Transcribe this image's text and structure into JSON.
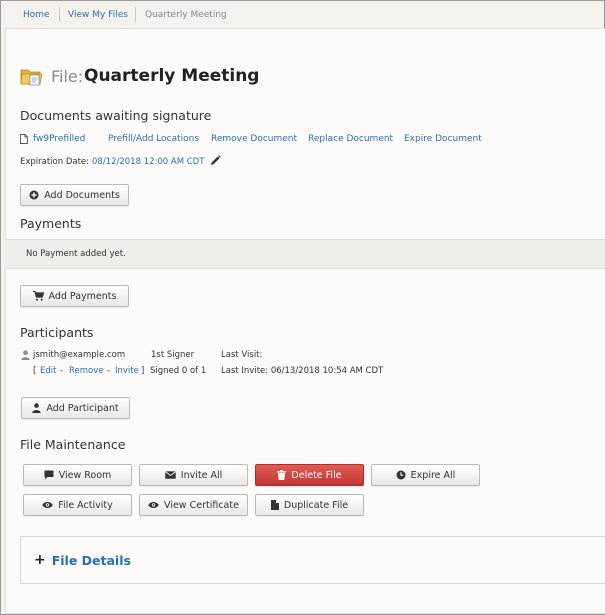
{
  "breadcrumb": {
    "home": "Home",
    "view_my_files": "View My Files",
    "current": "Quarterly Meeting"
  },
  "file": {
    "prefix": "File:",
    "name": "Quarterly Meeting"
  },
  "documents": {
    "heading": "Documents awaiting signature",
    "document_name": "fw9Prefilled",
    "actions": {
      "prefill": "Prefill/Add Locations",
      "remove": "Remove Document",
      "replace": "Replace Document",
      "expire": "Expire Document"
    },
    "expiration_label": "Expiration Date:",
    "expiration_value": "08/12/2018 12:00 AM CDT",
    "add_button": "Add Documents"
  },
  "payments": {
    "heading": "Payments",
    "empty_message": "No Payment added yet.",
    "add_button": "Add Payments"
  },
  "participants": {
    "heading": "Participants",
    "items": [
      {
        "email": "jsmith@example.com",
        "role": "1st Signer",
        "last_visit_label": "Last Visit:",
        "last_visit_value": "",
        "bracket_open": "[",
        "edit": "Edit",
        "dash1": "-",
        "remove": "Remove",
        "dash2": "-",
        "invite": "Invite",
        "bracket_close": "]",
        "signed_status": "Signed 0 of 1",
        "last_invite": "Last Invite: 06/13/2018 10:54 AM CDT"
      }
    ],
    "add_button": "Add Participant"
  },
  "maintenance": {
    "heading": "File Maintenance",
    "buttons": {
      "view_room": "View Room",
      "invite_all": "Invite All",
      "delete_file": "Delete File",
      "expire_all": "Expire All",
      "file_activity": "File Activity",
      "view_certificate": "View Certificate",
      "duplicate_file": "Duplicate File"
    }
  },
  "details": {
    "plus": "+",
    "label": "File Details"
  },
  "colors": {
    "link": "#2670b8",
    "danger": "#d0443f",
    "page_bg": "#fdfbf9"
  }
}
